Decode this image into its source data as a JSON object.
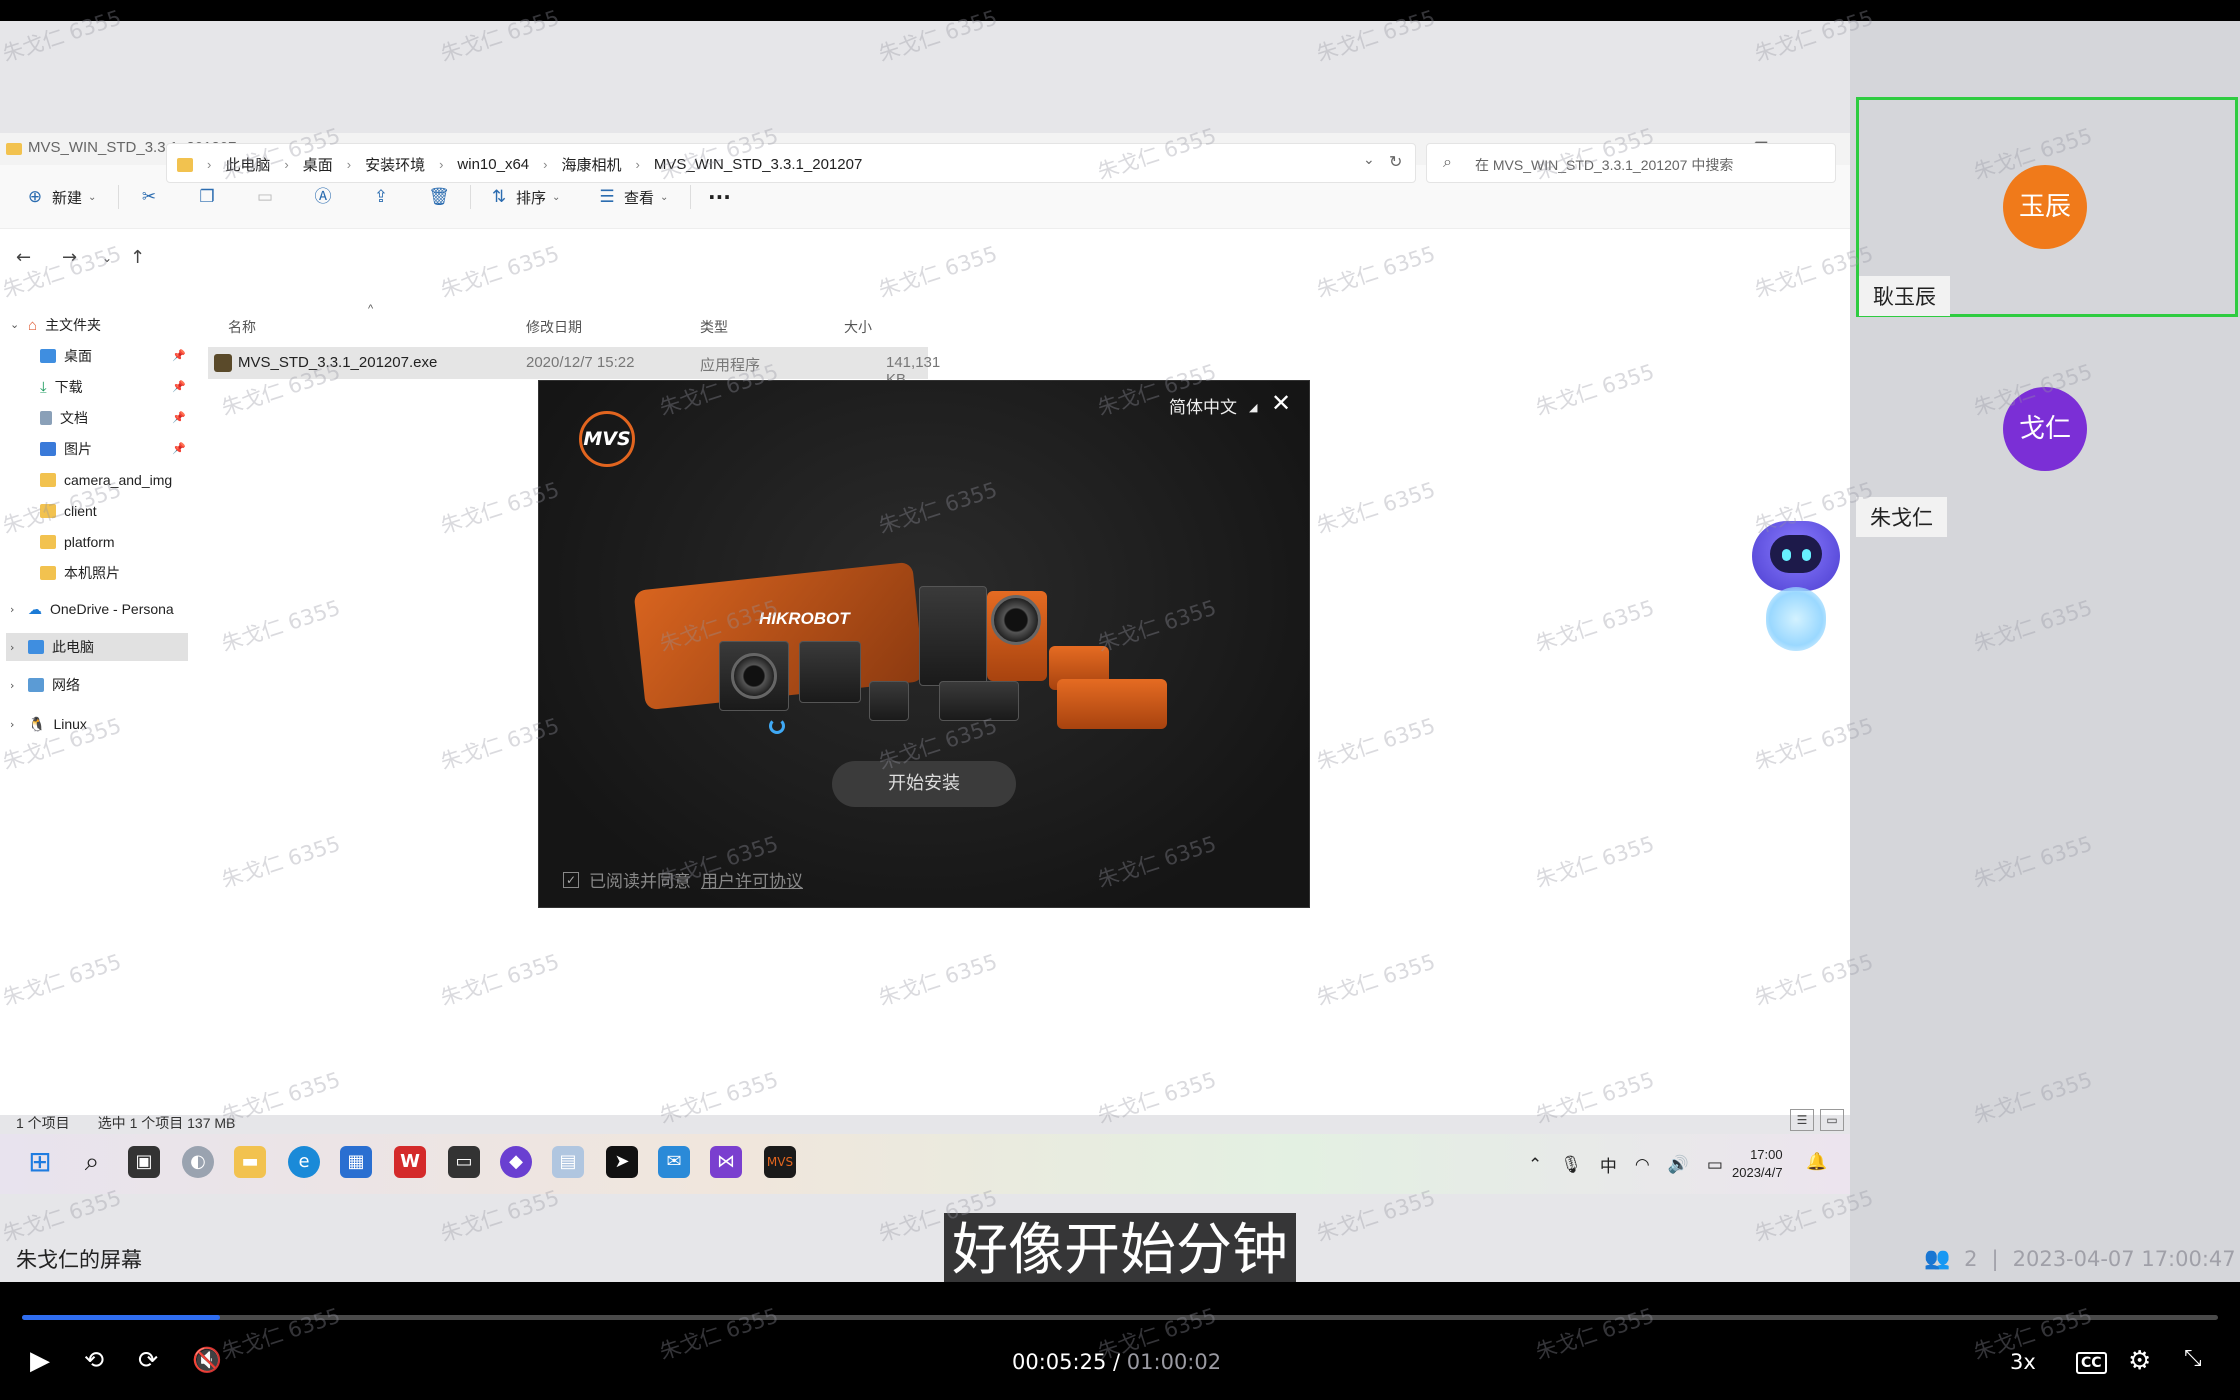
{
  "explorer": {
    "title": "MVS_WIN_STD_3.3.1_201207",
    "toolbar": {
      "new_label": "新建",
      "sort_label": "排序",
      "view_label": "查看",
      "more_label": "···"
    },
    "breadcrumbs": [
      "此电脑",
      "桌面",
      "安装环境",
      "win10_x64",
      "海康相机",
      "MVS_WIN_STD_3.3.1_201207"
    ],
    "search_placeholder": "在 MVS_WIN_STD_3.3.1_201207 中搜索",
    "nav": [
      {
        "label": "主文件夹"
      },
      {
        "label": "桌面"
      },
      {
        "label": "下载"
      },
      {
        "label": "文档"
      },
      {
        "label": "图片"
      },
      {
        "label": "camera_and_img"
      },
      {
        "label": "client"
      },
      {
        "label": "platform"
      },
      {
        "label": "本机照片"
      },
      {
        "label": "OneDrive - Persona"
      },
      {
        "label": "此电脑"
      },
      {
        "label": "网络"
      },
      {
        "label": "Linux"
      }
    ],
    "columns": {
      "name": "名称",
      "date": "修改日期",
      "type": "类型",
      "size": "大小"
    },
    "file": {
      "name": "MVS_STD_3.3.1_201207.exe",
      "date": "2020/12/7 15:22",
      "type": "应用程序",
      "size": "141,131 KB"
    },
    "status": {
      "count": "1 个项目",
      "selected": "选中 1 个项目  137 MB"
    }
  },
  "installer": {
    "logo_text": "MVS",
    "language": "简体中文",
    "brand": "HIKROBOT",
    "install_button": "开始安装",
    "agree_text": "已阅读并同意",
    "license_link": "用户许可协议"
  },
  "taskbar": {
    "ime": "中",
    "time": "17:00",
    "date": "2023/4/7"
  },
  "participants": [
    {
      "name": "耿玉辰",
      "avatar_text": "玉辰",
      "color": "#f07a1a",
      "active": true
    },
    {
      "name": "朱戈仁",
      "avatar_text": "戈仁",
      "color": "#7b2fd6",
      "active": false
    }
  ],
  "meeting": {
    "sharer_label": "朱戈仁的屏幕",
    "subtitle": "好像开始分钟",
    "participant_count": "2",
    "recorded_at": "2023-04-07 17:00:47",
    "watermark": "朱戈仁 6355"
  },
  "player": {
    "current_time": "00:05:25",
    "separator": "/",
    "total_time": "01:00:02",
    "progress": 0.09,
    "speed": "3x",
    "cc_label": "CC"
  },
  "colors": {
    "accent": "#2f6df0",
    "active_border": "#2ecc40",
    "mvs_orange": "#e2651f"
  }
}
